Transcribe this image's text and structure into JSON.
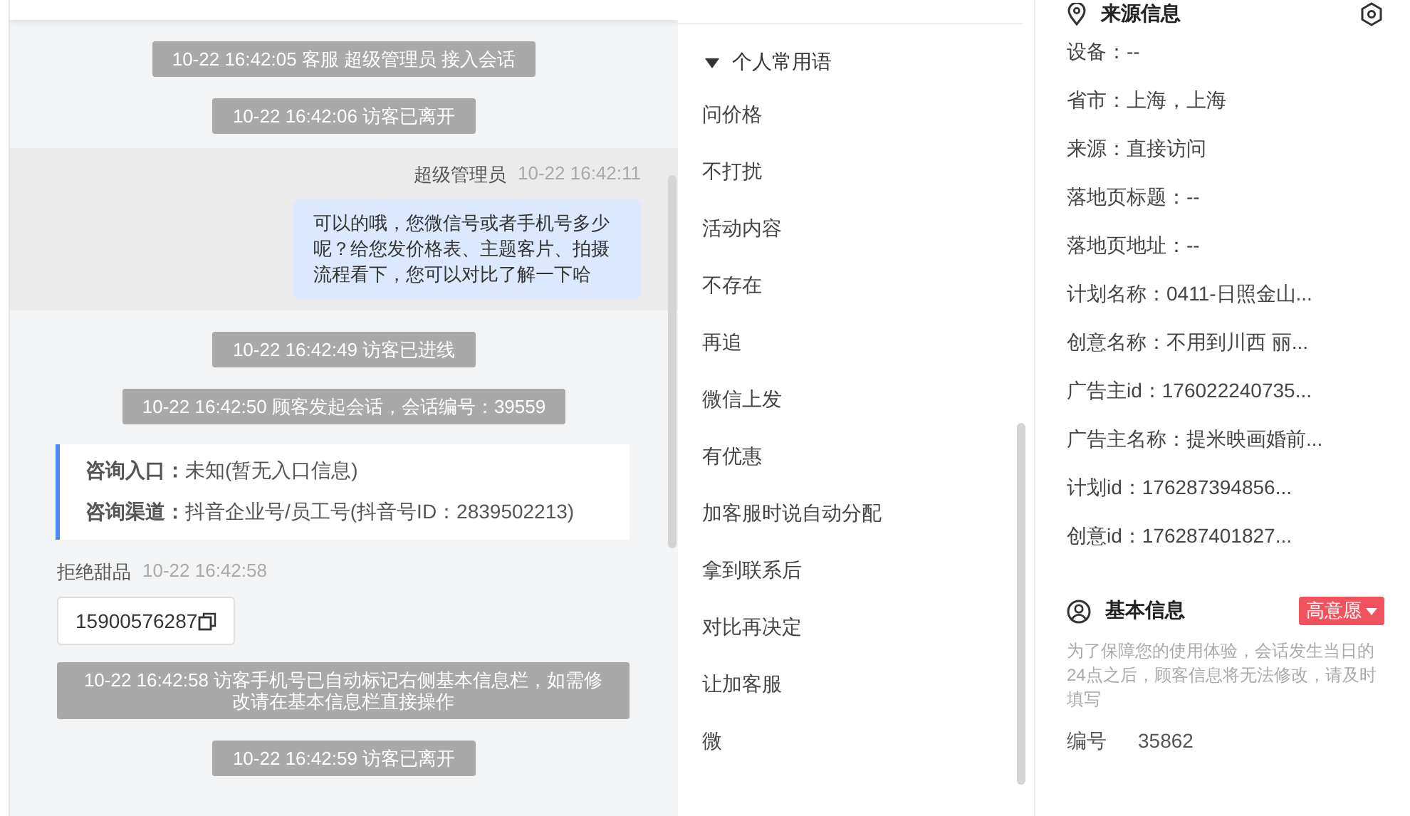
{
  "chat": {
    "messages": [
      {
        "kind": "system",
        "text": "10-22 16:42:05 客服 超级管理员 接入会话"
      },
      {
        "kind": "system",
        "text": "10-22 16:42:06 访客已离开"
      },
      {
        "kind": "agent",
        "sender": "超级管理员",
        "time": "10-22 16:42:11",
        "text": "可以的哦，您微信号或者手机号多少呢？给您发价格表、主题客片、拍摄流程看下，您可以对比了解一下哈"
      },
      {
        "kind": "system",
        "text": "10-22 16:42:49 访客已进线"
      },
      {
        "kind": "system",
        "text": "10-22 16:42:50 顾客发起会话，会话编号：39559"
      },
      {
        "kind": "info",
        "rows": [
          {
            "label": "咨询入口：",
            "value": "未知(暂无入口信息)"
          },
          {
            "label": "咨询渠道：",
            "value": "抖音企业号/员工号(抖音号ID：2839502213)"
          }
        ]
      },
      {
        "kind": "visitor",
        "sender": "拒绝甜品",
        "time": "10-22 16:42:58",
        "text": "15900576287"
      },
      {
        "kind": "system",
        "text": "10-22 16:42:58 访客手机号已自动标记右侧基本信息栏，如需修改请在基本信息栏直接操作"
      },
      {
        "kind": "system",
        "text": "10-22 16:42:59 访客已离开"
      }
    ]
  },
  "phrases": {
    "title": "个人常用语",
    "expanded": true,
    "items": [
      "问价格",
      "不打扰",
      "活动内容",
      "不存在",
      "再追",
      "微信上发",
      "有优惠",
      "加客服时说自动分配",
      "拿到联系后",
      "对比再决定",
      "让加客服",
      "微"
    ]
  },
  "source": {
    "title": "来源信息",
    "fields": [
      "设备：--",
      "省市：上海，上海",
      "来源：直接访问",
      "落地页标题：--",
      "落地页地址：--",
      "计划名称：0411-日照金山...",
      "创意名称：不用到川西 丽...",
      "广告主id：176022240735...",
      "广告主名称：提米映画婚前...",
      "计划id：176287394856...",
      "创意id：176287401827..."
    ]
  },
  "basic": {
    "title": "基本信息",
    "intent": "高意愿",
    "note": "为了保障您的使用体验，会话发生当日的24点之后，顾客信息将无法修改，请及时填写",
    "fields": [
      {
        "label": "编号",
        "value": "35862"
      }
    ]
  }
}
